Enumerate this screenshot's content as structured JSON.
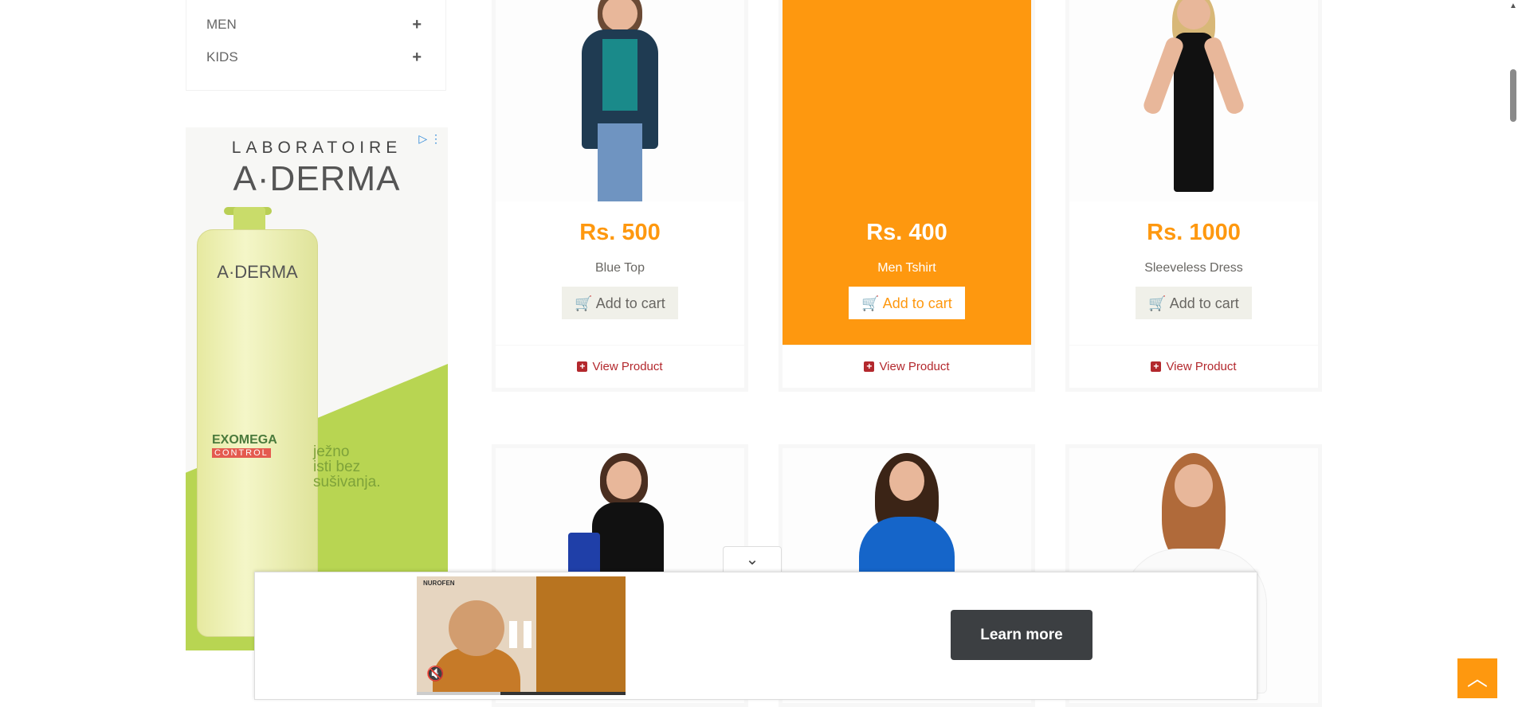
{
  "categories": [
    {
      "label": "MEN",
      "expand": "+"
    },
    {
      "label": "KIDS",
      "expand": "+"
    }
  ],
  "ad": {
    "line1": "LABORATOIRE",
    "line2": "A·DERMA",
    "bottle_brand": "A·DERMA",
    "product": "EXOMEGA",
    "product_sub": "CONTROL",
    "side_text": "ježno\nisti bez\nsušivanja.",
    "adchoice_icon": "adchoices-icon"
  },
  "products": [
    {
      "price": "Rs. 500",
      "name": "Blue Top",
      "cart_label": "Add to cart",
      "view_label": "View Product",
      "highlight": false
    },
    {
      "price": "Rs. 400",
      "name": "Men Tshirt",
      "cart_label": "Add to cart",
      "view_label": "View Product",
      "highlight": true
    },
    {
      "price": "Rs. 1000",
      "name": "Sleeveless Dress",
      "cart_label": "Add to cart",
      "view_label": "View Product",
      "highlight": false
    }
  ],
  "video_ad": {
    "brand": "NUROFEN",
    "cta": "Learn more",
    "collapse_icon": "chevron-down-icon",
    "progress_fraction": 0.4
  },
  "colors": {
    "accent": "#fe980f",
    "link": "#b3282d",
    "cta_bg": "#3c3f42"
  },
  "scroll_top_icon": "chevron-up-icon"
}
